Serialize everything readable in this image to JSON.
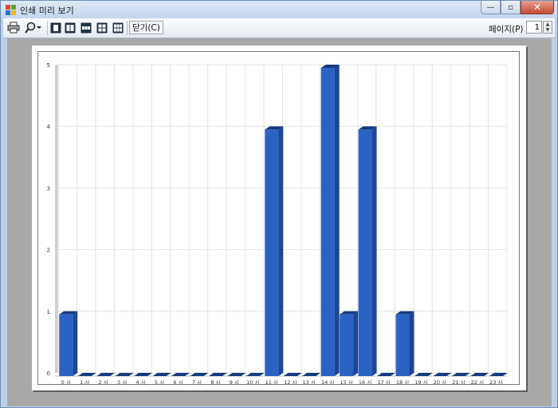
{
  "window": {
    "title": "인쇄 미리 보기",
    "minimize_symbol": "—",
    "maximize_symbol": "▫",
    "close_symbol": "✕"
  },
  "toolbar": {
    "print_icon": "printer-icon",
    "zoom_icon": "magnifier-icon",
    "layout_icons": [
      "one-page-icon",
      "two-pages-icon",
      "three-pages-icon",
      "four-pages-icon",
      "six-pages-icon"
    ],
    "close_label": "닫기(C)",
    "page_label": "페이지(P)",
    "page_value": "1"
  },
  "colors": {
    "bar_front": "#2a63c4",
    "bar_side": "#1c4594",
    "bar_top": "#173a80",
    "grid": "#e3e3e3"
  },
  "chart_data": {
    "type": "bar",
    "categories": [
      "0 시",
      "1 시",
      "2 시",
      "3 시",
      "4 시",
      "5 시",
      "6 시",
      "7 시",
      "8 시",
      "9 시",
      "10 시",
      "11 시",
      "12 시",
      "13 시",
      "14 시",
      "15 시",
      "16 시",
      "17 시",
      "18 시",
      "19 시",
      "20 시",
      "21 시",
      "22 시",
      "23 시"
    ],
    "values": [
      1,
      0,
      0,
      0,
      0,
      0,
      0,
      0,
      0,
      0,
      0,
      4,
      0,
      0,
      5,
      1,
      4,
      0,
      1,
      0,
      0,
      0,
      0,
      0
    ],
    "y_ticks": [
      "0",
      "1",
      "2",
      "3",
      "4",
      "5"
    ],
    "ylim": [
      0,
      5
    ],
    "grid": true,
    "style": "3d-bar"
  }
}
